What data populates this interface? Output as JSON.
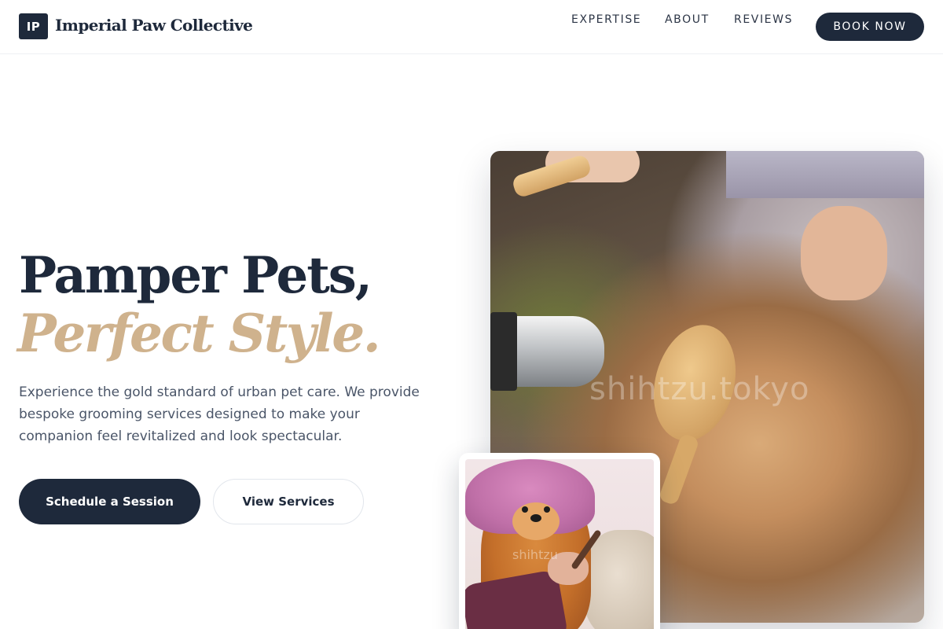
{
  "brand": {
    "logo_initials": "IP",
    "name": "Imperial Paw Collective"
  },
  "nav": {
    "items": [
      {
        "label": "EXPERTISE"
      },
      {
        "label": "ABOUT"
      },
      {
        "label": "REVIEWS"
      }
    ],
    "cta_label": "BOOK NOW"
  },
  "hero": {
    "headline_line1": "Pamper Pets,",
    "headline_line2": "Perfect Style.",
    "description": "Experience the gold standard of urban pet care. We provide bespoke grooming services designed to make your companion feel revitalized and look spectacular.",
    "primary_button": "Schedule a Session",
    "secondary_button": "View Services"
  },
  "images": {
    "main_watermark": "shihtzu.tokyo",
    "inset_watermark": "shihtzu"
  },
  "colors": {
    "navy": "#1e293b",
    "gold": "#cfb28d",
    "body_text": "#4a5568"
  }
}
